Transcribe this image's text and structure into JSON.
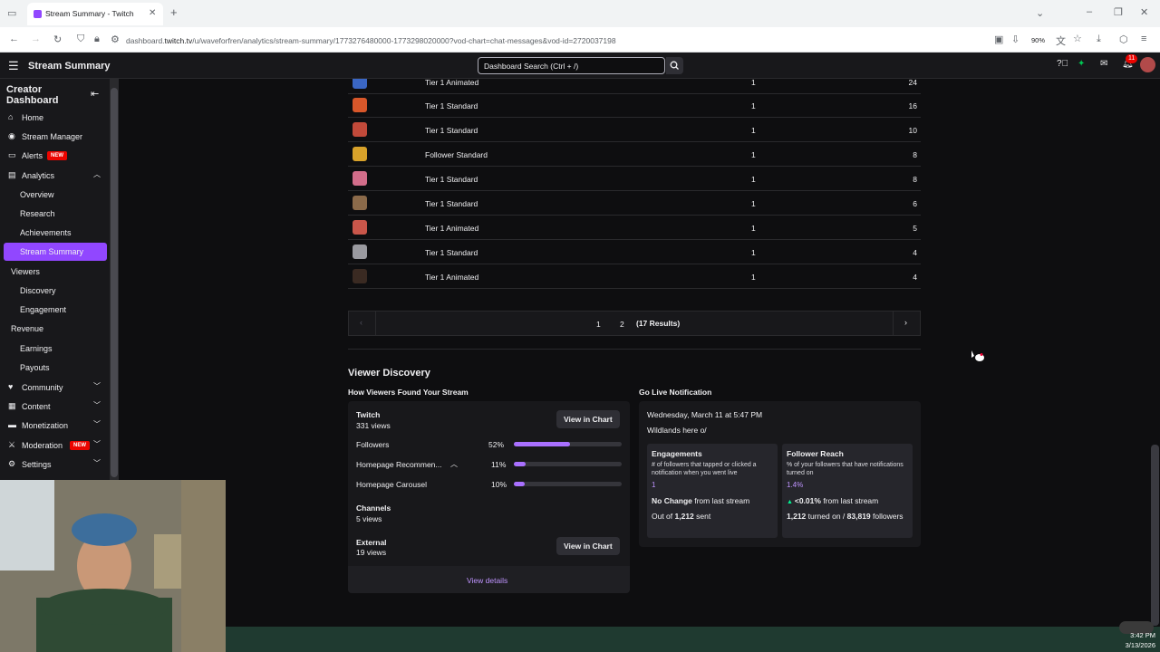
{
  "browser": {
    "tab_title": "Stream Summary - Twitch",
    "url_prefix": "dashboard.",
    "url_host": "twitch.tv",
    "url_path": "/u/waveforfren/analytics/stream-summary/1773276480000-1773298020000?vod-chart=chat-messages&vod-id=2720037198",
    "zoom": "90%",
    "notif_count": "11"
  },
  "header": {
    "title": "Stream Summary",
    "search_placeholder": "Dashboard Search (Ctrl + /)"
  },
  "sidebar": {
    "title": "Creator Dashboard",
    "new_badge": "NEW",
    "items": [
      {
        "label": "Home"
      },
      {
        "label": "Stream Manager"
      },
      {
        "label": "Alerts"
      },
      {
        "label": "Analytics"
      },
      {
        "label": "Overview"
      },
      {
        "label": "Research"
      },
      {
        "label": "Achievements"
      },
      {
        "label": "Stream Summary"
      },
      {
        "label": "Viewers"
      },
      {
        "label": "Discovery"
      },
      {
        "label": "Engagement"
      },
      {
        "label": "Revenue"
      },
      {
        "label": "Earnings"
      },
      {
        "label": "Payouts"
      },
      {
        "label": "Community"
      },
      {
        "label": "Content"
      },
      {
        "label": "Monetization"
      },
      {
        "label": "Moderation"
      },
      {
        "label": "Settings"
      }
    ]
  },
  "emote_table": {
    "rows": [
      {
        "type": "Tier 1 Animated",
        "count": "1",
        "messages": "24",
        "color": "#3a66c4"
      },
      {
        "type": "Tier 1 Standard",
        "count": "1",
        "messages": "16",
        "color": "#d8572a"
      },
      {
        "type": "Tier 1 Standard",
        "count": "1",
        "messages": "10",
        "color": "#c24a3a"
      },
      {
        "type": "Follower Standard",
        "count": "1",
        "messages": "8",
        "color": "#d8a22a"
      },
      {
        "type": "Tier 1 Standard",
        "count": "1",
        "messages": "8",
        "color": "#d26d8a"
      },
      {
        "type": "Tier 1 Standard",
        "count": "1",
        "messages": "6",
        "color": "#8b6a4a"
      },
      {
        "type": "Tier 1 Animated",
        "count": "1",
        "messages": "5",
        "color": "#c9564a"
      },
      {
        "type": "Tier 1 Standard",
        "count": "1",
        "messages": "4",
        "color": "#9a9aa0"
      },
      {
        "type": "Tier 1 Animated",
        "count": "1",
        "messages": "4",
        "color": "#3a2a22"
      }
    ],
    "pager": {
      "page1": "1",
      "page2": "2",
      "results": "(17 Results)"
    }
  },
  "viewer_discovery": {
    "title": "Viewer Discovery",
    "how_found_title": "How Viewers Found Your Stream",
    "twitch_label": "Twitch",
    "twitch_views": "331 views",
    "view_in_chart": "View in Chart",
    "sources": [
      {
        "label": "Followers",
        "pct": "52%",
        "value": 0.52
      },
      {
        "label": "Homepage Recommen...",
        "pct": "11%",
        "value": 0.11
      },
      {
        "label": "Homepage Carousel",
        "pct": "10%",
        "value": 0.1
      }
    ],
    "channels_label": "Channels",
    "channels_views": "5 views",
    "external_label": "External",
    "external_views": "19 views",
    "view_details": "View details"
  },
  "go_live": {
    "title": "Go Live Notification",
    "date": "Wednesday, March 11 at 5:47 PM",
    "message": "Wildlands here o/",
    "engagements": {
      "title": "Engagements",
      "desc": "# of followers that tapped or clicked a notification when you went live",
      "value": "1",
      "change_bold": "No Change",
      "change_rest": " from last stream",
      "out_of": "Out of ",
      "sent_bold": "1,212",
      "sent_rest": " sent"
    },
    "reach": {
      "title": "Follower Reach",
      "desc": "% of your followers that have notifications turned on",
      "value": "1.4%",
      "change_bold": "<0.01%",
      "change_rest": " from last stream",
      "turned_on_bold": "1,212",
      "turned_on_rest": " turned on / ",
      "followers_bold": "83,819",
      "followers_rest": " followers"
    }
  },
  "clock": {
    "time": "3:42 PM",
    "date": "3/13/2026"
  },
  "colors": {
    "accent": "#9147ff",
    "bar": "#a970ff",
    "bg": "#0e0e10",
    "panel": "#18181b"
  }
}
